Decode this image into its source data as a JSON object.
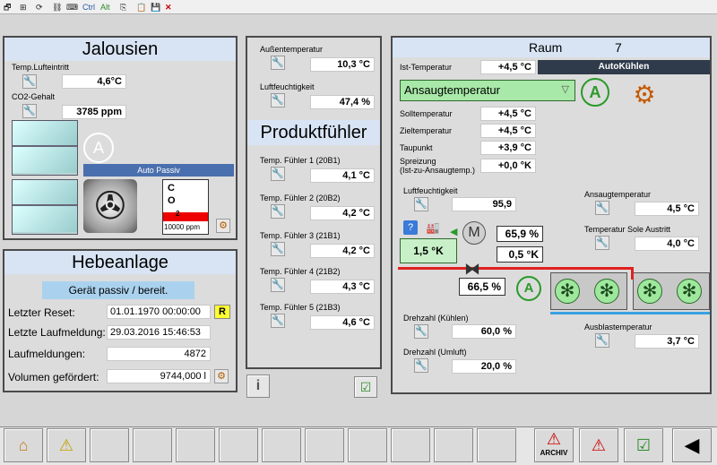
{
  "toolbar": {
    "ctrl": "Ctrl",
    "alt": "Alt"
  },
  "jalousien": {
    "title": "Jalousien",
    "temp_label": "Temp.Lufteintritt",
    "temp_value": "4,6°C",
    "co2_label": "CO2-Gehalt",
    "co2_value": "3785 ppm",
    "status": "Auto Passiv",
    "co2_letter1": "C",
    "co2_letter2": "O",
    "co2_letter3": "2",
    "co2_max": "10000 ppm"
  },
  "hebeanlage": {
    "title": "Hebeanlage",
    "status": "Gerät passiv / bereit.",
    "reset_label": "Letzter Reset:",
    "reset_value": "01.01.1970 00:00:00",
    "reset_button": "R",
    "laufmeldung_label": "Letzte Laufmeldung:",
    "laufmeldung_value": "29.03.2016 15:46:53",
    "laufmeldungen_label": "Laufmeldungen:",
    "laufmeldungen_value": "4872",
    "volumen_label": "Volumen gefördert:",
    "volumen_value": "9744,000 l"
  },
  "aussen": {
    "temp_label": "Außentemperatur",
    "temp_value": "10,3 °C",
    "humidity_label": "Luftfeuchtigkeit",
    "humidity_value": "47,4 %"
  },
  "produktfuehler": {
    "title": "Produktfühler",
    "sensors": [
      {
        "label": "Temp. Fühler 1 (20B1)",
        "value": "4,1 °C"
      },
      {
        "label": "Temp. Fühler 2 (20B2)",
        "value": "4,2 °C"
      },
      {
        "label": "Temp. Fühler 3 (21B1)",
        "value": "4,2 °C"
      },
      {
        "label": "Temp. Fühler 4 (21B2)",
        "value": "4,3 °C"
      },
      {
        "label": "Temp. Fühler 5 (21B3)",
        "value": "4,6 °C"
      }
    ],
    "info_button": "i"
  },
  "raum": {
    "title": "Raum",
    "number": "7",
    "mode": "AutoKühlen",
    "ist_label": "Ist-Temperatur",
    "ist_value": "+4,5 °C",
    "dropdown_value": "Ansaugtemperatur",
    "soll_label": "Solltemperatur",
    "soll_value": "+4,5 °C",
    "ziel_label": "Zieltemperatur",
    "ziel_value": "+4,5 °C",
    "taupunkt_label": "Taupunkt",
    "taupunkt_value": "+3,9 °C",
    "spreizung_label1": "Spreizung",
    "spreizung_label2": "(Ist-zu-Ansaugtemp.)",
    "spreizung_value": "+0,0 °K",
    "luftfeuchte_label": "Luftfeuchtigkeit",
    "luftfeuchte_value": "95,9",
    "ansaug_label": "Ansaugtemperatur",
    "ansaug_value": "4,5 °C",
    "sole_label": "Temperatur Sole Austritt",
    "sole_value": "4,0 °C",
    "valve_k": "1,5 °K",
    "motor_letter": "M",
    "valve_pct1": "65,9 %",
    "valve_k2": "0,5 °K",
    "valve_pct2": "66,5 %",
    "drehzahl_kuehl_label": "Drehzahl (Kühlen)",
    "drehzahl_kuehl_value": "60,0 %",
    "drehzahl_umluft_label": "Drehzahl (Umluft)",
    "drehzahl_umluft_value": "20,0 %",
    "ausblas_label": "Ausblastemperatur",
    "ausblas_value": "3,7 °C"
  },
  "bottom": {
    "archiv_label": "ARCHIV"
  }
}
